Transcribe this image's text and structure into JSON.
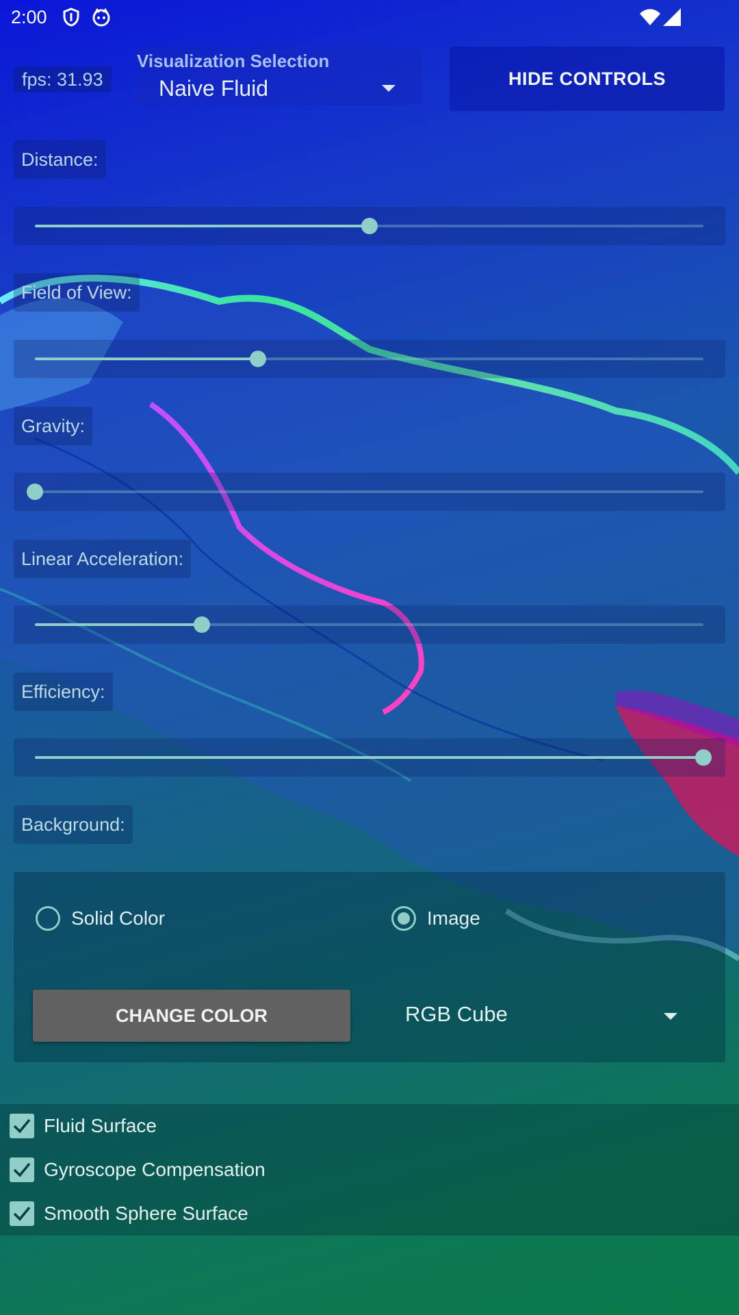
{
  "status_bar": {
    "time": "2:00",
    "icons": [
      "shield-icon",
      "cat-icon",
      "wifi-icon",
      "signal-icon"
    ]
  },
  "header": {
    "fps": "fps: 31.93",
    "visualization": {
      "title": "Visualization Selection",
      "selected": "Naive Fluid"
    },
    "hide_controls_label": "HIDE CONTROLS"
  },
  "sliders": [
    {
      "label": "Distance:",
      "value": 0.5
    },
    {
      "label": "Field of View:",
      "value": 0.334
    },
    {
      "label": "Gravity:",
      "value": 0.0
    },
    {
      "label": "Linear Acceleration:",
      "value": 0.25
    },
    {
      "label": "Efficiency:",
      "value": 1.0
    }
  ],
  "background": {
    "label": "Background:",
    "options": [
      {
        "label": "Solid Color",
        "checked": false
      },
      {
        "label": "Image",
        "checked": true
      }
    ],
    "change_color_label": "CHANGE COLOR",
    "image_selected": "RGB Cube"
  },
  "checkboxes": [
    {
      "label": "Fluid Surface",
      "checked": true
    },
    {
      "label": "Gyroscope Compensation",
      "checked": true
    },
    {
      "label": "Smooth Sphere Surface",
      "checked": true
    }
  ],
  "colors": {
    "accent": "#8fcfc8",
    "button_gray": "#616161",
    "hide_button": "#0d1aa8"
  }
}
